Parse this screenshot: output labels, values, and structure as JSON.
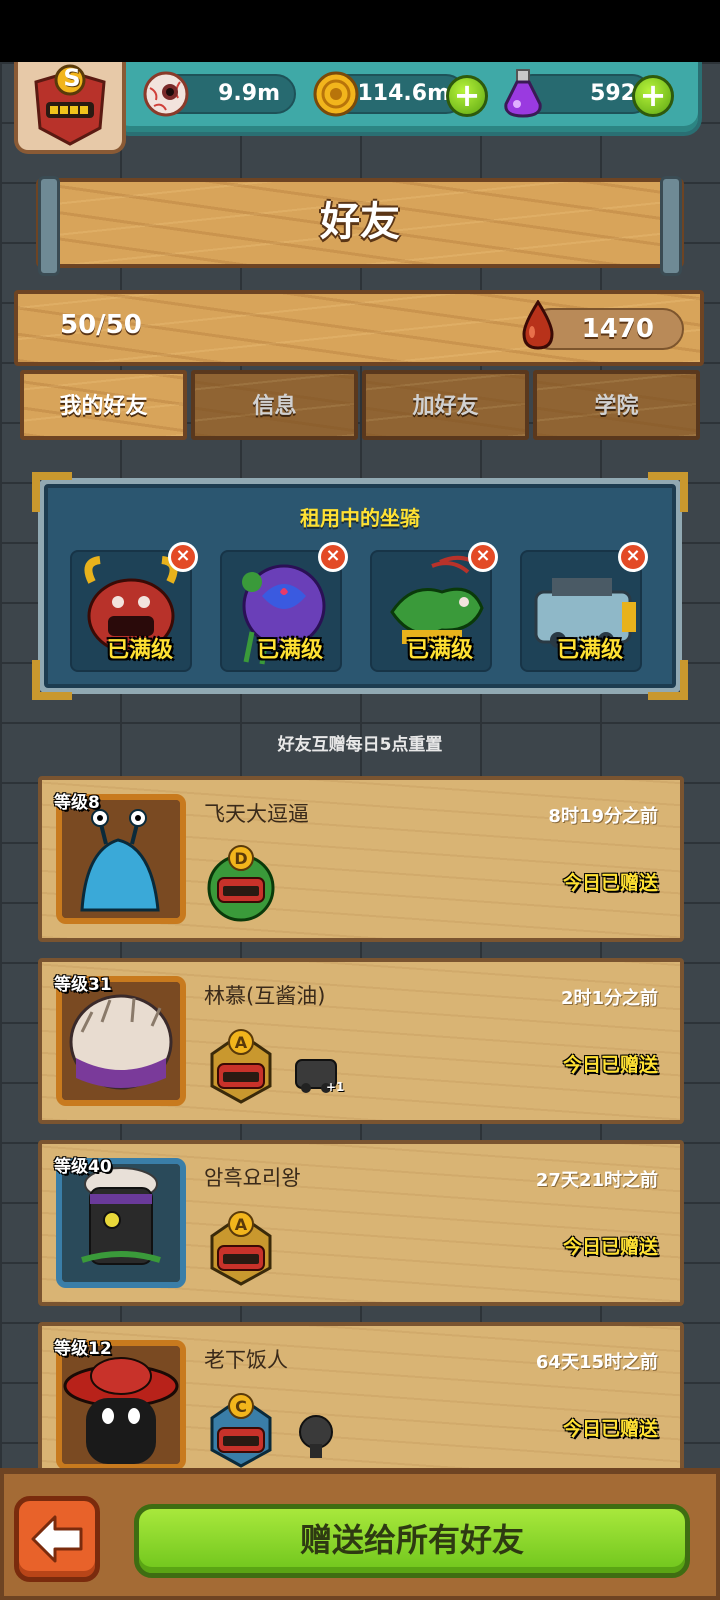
{
  "resources": {
    "eyeball": "9.9m",
    "coins": "114.6m",
    "potion": "592",
    "plus_symbol": "+"
  },
  "player_rank": "S",
  "title": "好友",
  "friend_count": "50/50",
  "blood": "1470",
  "tabs": [
    "我的好友",
    "信息",
    "加好友",
    "学院"
  ],
  "mounts": {
    "title": "租用中的坐骑",
    "close_symbol": "×",
    "items": [
      {
        "level_label": "已满级",
        "color": "#b8322a"
      },
      {
        "level_label": "已满级",
        "color": "#6a3fb8"
      },
      {
        "level_label": "已满级",
        "color": "#3a9a3a"
      },
      {
        "level_label": "已满级",
        "color": "#8fb8c8"
      }
    ]
  },
  "reset_note": "好友互赠每日5点重置",
  "friends": [
    {
      "level": "等级8",
      "name": "飞天大逗逼",
      "time": "8时19分之前",
      "status": "今日已赠送",
      "rank": "D",
      "rank_color": "#3a9a3a",
      "extra": ""
    },
    {
      "level": "等级31",
      "name": "林慕(互酱油)",
      "time": "2时1分之前",
      "status": "今日已赠送",
      "rank": "A",
      "rank_color": "#c9982e",
      "extra": "+1"
    },
    {
      "level": "等级40",
      "name": "암흑요리왕",
      "time": "27天21时之前",
      "status": "今日已赠送",
      "rank": "A",
      "rank_color": "#c9982e",
      "extra": ""
    },
    {
      "level": "等级12",
      "name": "老下饭人",
      "time": "64天15时之前",
      "status": "今日已赠送",
      "rank": "C",
      "rank_color": "#3a7ea8",
      "extra": ""
    }
  ],
  "gift_all_label": "赠送给所有好友"
}
